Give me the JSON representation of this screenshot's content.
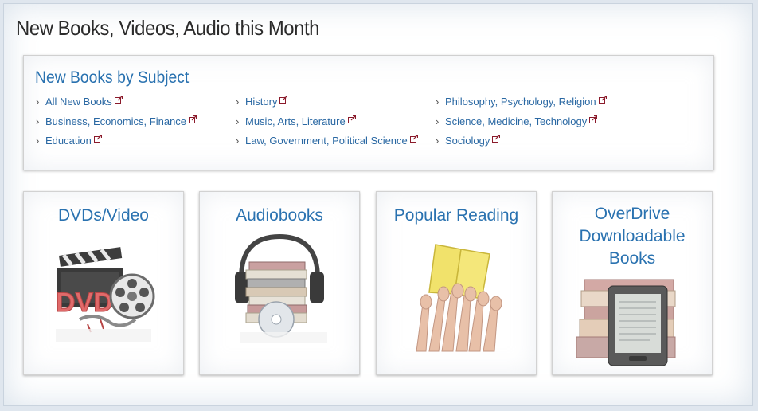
{
  "page": {
    "title": "New Books, Videos, Audio this Month"
  },
  "subjects": {
    "title": "New Books by Subject",
    "columns": [
      [
        "All New Books",
        "Business, Economics, Finance",
        "Education"
      ],
      [
        "History",
        "Music, Arts, Literature",
        "Law, Government, Political Science"
      ],
      [
        "Philosophy, Psychology, Religion",
        "Science, Medicine, Technology",
        "Sociology"
      ]
    ]
  },
  "cards": [
    {
      "title": "DVDs/Video"
    },
    {
      "title": "Audiobooks"
    },
    {
      "title": "Popular Reading"
    },
    {
      "title": "OverDrive Downloadable Books"
    }
  ],
  "icons": {
    "chevron": "chevron-right-icon",
    "external": "external-link-icon"
  },
  "colors": {
    "link": "#2a68a3",
    "heading": "#2a72b0",
    "external_icon": "#8b1a2b"
  }
}
